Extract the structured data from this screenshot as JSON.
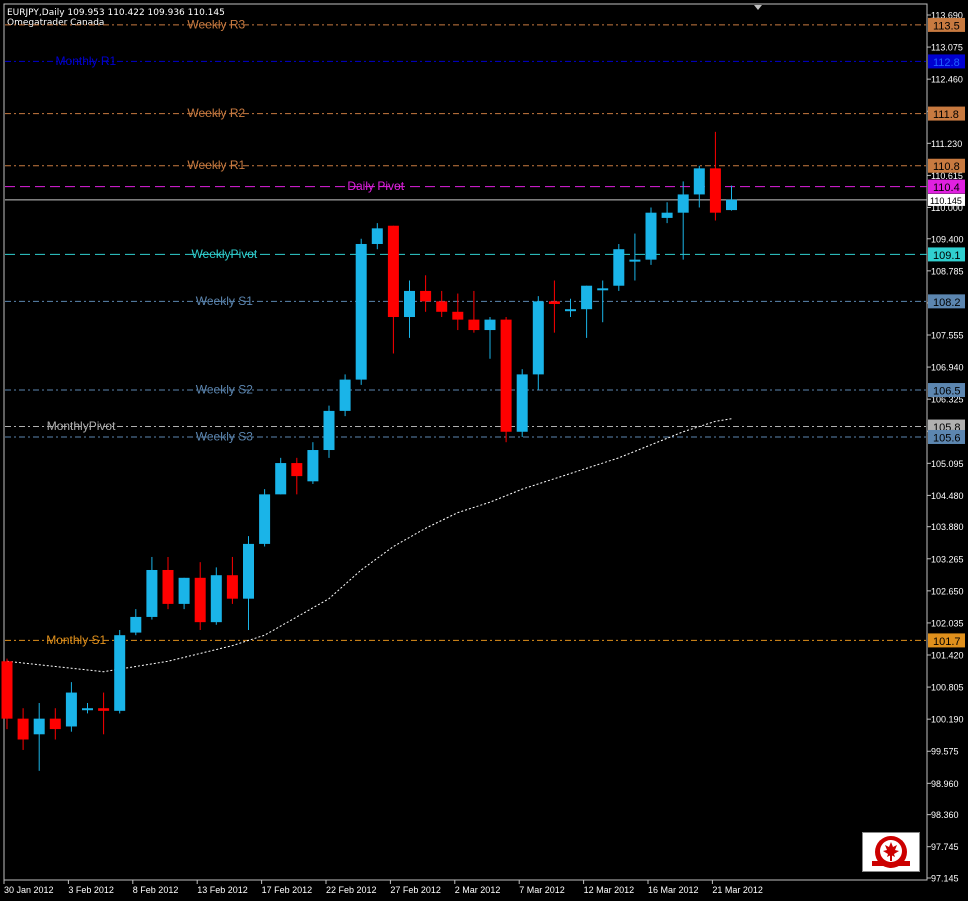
{
  "header": {
    "symbol_line": "EURJPY,Daily  109.953 110.422 109.936 110.145",
    "broker": "Omegatrader Canada"
  },
  "logo": {
    "name": "omegatrader-canada-logo"
  },
  "colors": {
    "background": "#000000",
    "frame": "#c0c0c0",
    "bull": "#1ab4e8",
    "bear": "#ff0000",
    "text": "#ffffff",
    "moving_average": "#ffffff"
  },
  "chart_data": {
    "type": "candlestick",
    "title": "",
    "symbol": "EURJPY",
    "timeframe": "Daily",
    "ylim": [
      97.145,
      113.69
    ],
    "y_ticks": [
      "113.690",
      "113.075",
      "112.460",
      "111.845",
      "111.230",
      "110.615",
      "110.000",
      "109.400",
      "108.785",
      "108.170",
      "107.555",
      "106.940",
      "106.325",
      "105.710",
      "105.095",
      "104.480",
      "103.880",
      "103.265",
      "102.650",
      "102.035",
      "101.420",
      "100.805",
      "100.190",
      "99.575",
      "98.960",
      "98.360",
      "97.745",
      "97.145"
    ],
    "x_labels": [
      {
        "bar": 0,
        "text": "30 Jan 2012"
      },
      {
        "bar": 4,
        "text": "3 Feb 2012"
      },
      {
        "bar": 8,
        "text": "8 Feb 2012"
      },
      {
        "bar": 12,
        "text": "13 Feb 2012"
      },
      {
        "bar": 16,
        "text": "17 Feb 2012"
      },
      {
        "bar": 20,
        "text": "22 Feb 2012"
      },
      {
        "bar": 24,
        "text": "27 Feb 2012"
      },
      {
        "bar": 28,
        "text": "2 Mar 2012"
      },
      {
        "bar": 32,
        "text": "7 Mar 2012"
      },
      {
        "bar": 36,
        "text": "12 Mar 2012"
      },
      {
        "bar": 40,
        "text": "16 Mar 2012"
      },
      {
        "bar": 44,
        "text": "21 Mar 2012"
      }
    ],
    "candles": [
      {
        "o": 101.3,
        "h": 101.35,
        "l": 100.0,
        "c": 100.2
      },
      {
        "o": 100.2,
        "h": 100.4,
        "l": 99.6,
        "c": 99.8
      },
      {
        "o": 99.9,
        "h": 100.5,
        "l": 99.2,
        "c": 100.2
      },
      {
        "o": 100.2,
        "h": 100.4,
        "l": 99.8,
        "c": 100.0
      },
      {
        "o": 100.05,
        "h": 100.9,
        "l": 99.95,
        "c": 100.7
      },
      {
        "o": 100.4,
        "h": 100.5,
        "l": 100.3,
        "c": 100.4
      },
      {
        "o": 100.4,
        "h": 100.7,
        "l": 99.9,
        "c": 100.35
      },
      {
        "o": 100.35,
        "h": 101.9,
        "l": 100.3,
        "c": 101.8
      },
      {
        "o": 101.85,
        "h": 102.3,
        "l": 101.8,
        "c": 102.15
      },
      {
        "o": 102.15,
        "h": 103.3,
        "l": 102.1,
        "c": 103.05
      },
      {
        "o": 103.05,
        "h": 103.3,
        "l": 102.3,
        "c": 102.4
      },
      {
        "o": 102.4,
        "h": 102.9,
        "l": 102.3,
        "c": 102.9
      },
      {
        "o": 102.9,
        "h": 103.2,
        "l": 101.9,
        "c": 102.05
      },
      {
        "o": 102.05,
        "h": 103.1,
        "l": 102.0,
        "c": 102.95
      },
      {
        "o": 102.95,
        "h": 103.3,
        "l": 102.4,
        "c": 102.5
      },
      {
        "o": 102.5,
        "h": 103.7,
        "l": 101.9,
        "c": 103.55
      },
      {
        "o": 103.55,
        "h": 104.6,
        "l": 103.5,
        "c": 104.5
      },
      {
        "o": 104.5,
        "h": 105.2,
        "l": 104.5,
        "c": 105.1
      },
      {
        "o": 105.1,
        "h": 105.2,
        "l": 104.5,
        "c": 104.85
      },
      {
        "o": 104.75,
        "h": 105.5,
        "l": 104.7,
        "c": 105.35
      },
      {
        "o": 105.35,
        "h": 106.2,
        "l": 105.2,
        "c": 106.1
      },
      {
        "o": 106.1,
        "h": 106.8,
        "l": 106.0,
        "c": 106.7
      },
      {
        "o": 106.7,
        "h": 109.4,
        "l": 106.6,
        "c": 109.3
      },
      {
        "o": 109.3,
        "h": 109.7,
        "l": 109.2,
        "c": 109.6
      },
      {
        "o": 109.65,
        "h": 109.65,
        "l": 107.2,
        "c": 107.9
      },
      {
        "o": 107.9,
        "h": 108.6,
        "l": 107.5,
        "c": 108.4
      },
      {
        "o": 108.4,
        "h": 108.7,
        "l": 108.0,
        "c": 108.2
      },
      {
        "o": 108.2,
        "h": 108.4,
        "l": 107.9,
        "c": 108.0
      },
      {
        "o": 108.0,
        "h": 108.35,
        "l": 107.65,
        "c": 107.85
      },
      {
        "o": 107.85,
        "h": 108.4,
        "l": 107.6,
        "c": 107.65
      },
      {
        "o": 107.65,
        "h": 107.9,
        "l": 107.1,
        "c": 107.85
      },
      {
        "o": 107.85,
        "h": 107.9,
        "l": 105.5,
        "c": 105.7
      },
      {
        "o": 105.7,
        "h": 106.9,
        "l": 105.6,
        "c": 106.8
      },
      {
        "o": 106.8,
        "h": 108.3,
        "l": 106.5,
        "c": 108.2
      },
      {
        "o": 108.2,
        "h": 108.6,
        "l": 107.6,
        "c": 108.15
      },
      {
        "o": 108.05,
        "h": 108.25,
        "l": 107.9,
        "c": 108.05
      },
      {
        "o": 108.05,
        "h": 108.5,
        "l": 107.5,
        "c": 108.5
      },
      {
        "o": 108.45,
        "h": 108.6,
        "l": 107.8,
        "c": 108.45
      },
      {
        "o": 108.5,
        "h": 109.3,
        "l": 108.4,
        "c": 109.2
      },
      {
        "o": 109.0,
        "h": 109.5,
        "l": 108.6,
        "c": 109.0
      },
      {
        "o": 109.0,
        "h": 110.0,
        "l": 108.9,
        "c": 109.9
      },
      {
        "o": 109.8,
        "h": 110.1,
        "l": 109.7,
        "c": 109.9
      },
      {
        "o": 109.9,
        "h": 110.5,
        "l": 109.0,
        "c": 110.25
      },
      {
        "o": 110.25,
        "h": 110.8,
        "l": 110.0,
        "c": 110.75
      },
      {
        "o": 110.75,
        "h": 111.45,
        "l": 109.75,
        "c": 109.9
      },
      {
        "o": 109.95,
        "h": 110.42,
        "l": 109.94,
        "c": 110.15
      }
    ],
    "moving_average": [
      {
        "bar": 0,
        "v": 101.3
      },
      {
        "bar": 6,
        "v": 101.1
      },
      {
        "bar": 10,
        "v": 101.3
      },
      {
        "bar": 14,
        "v": 101.6
      },
      {
        "bar": 16,
        "v": 101.8
      },
      {
        "bar": 18,
        "v": 102.15
      },
      {
        "bar": 20,
        "v": 102.5
      },
      {
        "bar": 22,
        "v": 103.05
      },
      {
        "bar": 24,
        "v": 103.5
      },
      {
        "bar": 26,
        "v": 103.85
      },
      {
        "bar": 28,
        "v": 104.15
      },
      {
        "bar": 30,
        "v": 104.35
      },
      {
        "bar": 32,
        "v": 104.6
      },
      {
        "bar": 34,
        "v": 104.8
      },
      {
        "bar": 36,
        "v": 105.0
      },
      {
        "bar": 38,
        "v": 105.2
      },
      {
        "bar": 40,
        "v": 105.45
      },
      {
        "bar": 42,
        "v": 105.7
      },
      {
        "bar": 44,
        "v": 105.9
      },
      {
        "bar": 45,
        "v": 105.95
      }
    ],
    "levels": [
      {
        "label": "Weekly R3",
        "value": 113.5,
        "tag": "113.5",
        "color": "#c87a40",
        "dash": "6,3,2,3",
        "label_bar": 13.0
      },
      {
        "label": "Monthly R1",
        "value": 112.8,
        "tag": "112.8",
        "color": "#0000d0",
        "dash": "6,3,2,3",
        "label_bar": 4.9,
        "tag_bg": "#0000d0",
        "tag_fg": "#2060ff"
      },
      {
        "label": "Weekly R2",
        "value": 111.8,
        "tag": "111.8",
        "color": "#c87a40",
        "dash": "6,3,2,3",
        "label_bar": 13.0
      },
      {
        "label": "Weekly R1",
        "value": 110.8,
        "tag": "110.8",
        "color": "#c87a40",
        "dash": "6,3,2,3",
        "label_bar": 13.0
      },
      {
        "label": "Daily Pivot",
        "value": 110.4,
        "tag": "110.4",
        "color": "#e020e0",
        "dash": "10,5",
        "label_bar": 22.9
      },
      {
        "label": "WeeklyPivot",
        "value": 109.1,
        "tag": "109.1",
        "color": "#30d0d0",
        "dash": "10,5",
        "label_bar": 13.5
      },
      {
        "label": "Weekly S1",
        "value": 108.2,
        "tag": "108.2",
        "color": "#5c86b0",
        "dash": "6,3,2,3",
        "label_bar": 13.5
      },
      {
        "label": "Weekly S2",
        "value": 106.5,
        "tag": "106.5",
        "color": "#5c86b0",
        "dash": "6,3,2,3",
        "label_bar": 13.5
      },
      {
        "label": "MonthlyPivot",
        "value": 105.8,
        "tag": "105.8",
        "color": "#b0b0b0",
        "dash": "6,3,2,3",
        "label_bar": 4.6
      },
      {
        "label": "Weekly S3",
        "value": 105.6,
        "tag": "105.6",
        "color": "#5c86b0",
        "dash": "6,3,2,3",
        "label_bar": 13.5
      },
      {
        "label": "Monthly S1",
        "value": 101.7,
        "tag": "101.7",
        "color": "#e0901c",
        "dash": "6,3,2,3",
        "label_bar": 4.3
      }
    ],
    "current_price": {
      "value": 110.145,
      "tag": "110.145"
    },
    "grid": false
  }
}
